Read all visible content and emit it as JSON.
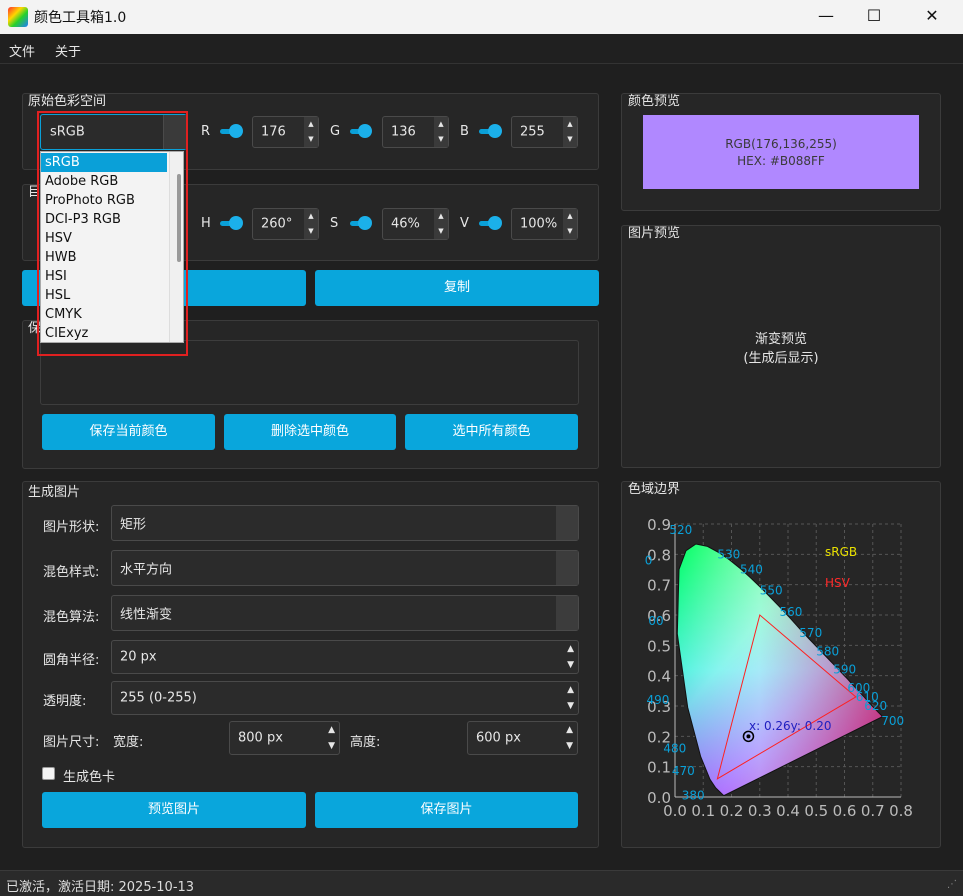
{
  "window": {
    "title": "颜色工具箱1.0",
    "minimize": "—",
    "maximize": "☐",
    "close": "✕"
  },
  "menu": [
    "文件",
    "关于"
  ],
  "source_space": {
    "title": "原始色彩空间",
    "selected": "sRGB",
    "channels": [
      {
        "label": "R",
        "value": "176"
      },
      {
        "label": "G",
        "value": "136"
      },
      {
        "label": "B",
        "value": "255"
      }
    ]
  },
  "dropdown": {
    "options": [
      "sRGB",
      "Adobe RGB",
      "ProPhoto RGB",
      "DCI-P3 RGB",
      "HSV",
      "HWB",
      "HSI",
      "HSL",
      "CMYK",
      "CIExyz"
    ]
  },
  "target_space": {
    "title_fragment": "目",
    "channels": [
      {
        "label": "H",
        "value": "260°"
      },
      {
        "label": "S",
        "value": "46%"
      },
      {
        "label": "V",
        "value": "100%"
      }
    ]
  },
  "copy_button": "复制",
  "saved_colors": {
    "title_fragment": "保",
    "buttons": [
      "保存当前颜色",
      "删除选中颜色",
      "选中所有颜色"
    ]
  },
  "generate": {
    "title": "生成图片",
    "shape_label": "图片形状:",
    "shape_value": "矩形",
    "blend_style_label": "混色样式:",
    "blend_style_value": "水平方向",
    "blend_algo_label": "混色算法:",
    "blend_algo_value": "线性渐变",
    "radius_label": "圆角半径:",
    "radius_value": "20 px",
    "alpha_label": "透明度:",
    "alpha_value": "255 (0-255)",
    "size_label": "图片尺寸:",
    "width_label": "宽度:",
    "width_value": "800 px",
    "height_label": "高度:",
    "height_value": "600 px",
    "swatch_label": "生成色卡",
    "preview_button": "预览图片",
    "save_button": "保存图片"
  },
  "color_preview": {
    "title": "颜色预览",
    "rgb_text": "RGB(176,136,255)",
    "hex_text": "HEX: #B088FF",
    "swatch_color": "#B088FF"
  },
  "image_preview": {
    "title": "图片预览",
    "line1": "渐变预览",
    "line2": "(生成后显示)"
  },
  "gamut": {
    "title": "色域边界",
    "legend": [
      {
        "name": "sRGB",
        "color": "#e8e000"
      },
      {
        "name": "HSV",
        "color": "#ff2a2a"
      }
    ],
    "point_label": "x: 0.26y: 0.20"
  },
  "chart_data": {
    "type": "scatter",
    "title": "",
    "xlim": [
      0.0,
      0.8
    ],
    "ylim": [
      0.0,
      0.9
    ],
    "x_ticks": [
      "0.0",
      "0.1",
      "0.2",
      "0.3",
      "0.4",
      "0.5",
      "0.6",
      "0.7",
      "0.8"
    ],
    "y_ticks": [
      "0.0",
      "0.1",
      "0.2",
      "0.3",
      "0.4",
      "0.5",
      "0.6",
      "0.7",
      "0.8",
      "0.9"
    ],
    "wavelength_labels": [
      "380",
      "470",
      "480",
      "490",
      "00",
      "0",
      "520",
      "530",
      "540",
      "550",
      "560",
      "570",
      "580",
      "590",
      "600",
      "610",
      "620",
      "700"
    ],
    "triangle": [
      [
        0.64,
        0.33
      ],
      [
        0.3,
        0.6
      ],
      [
        0.15,
        0.06
      ]
    ],
    "point": [
      0.26,
      0.2
    ],
    "grid": true
  },
  "status": {
    "text": "已激活，激活日期: 2025-10-13"
  }
}
